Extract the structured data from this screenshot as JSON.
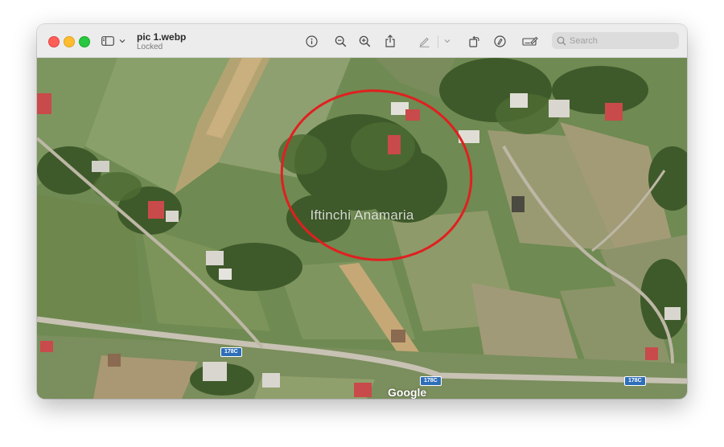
{
  "window": {
    "title": "pic 1.webp",
    "subtitle": "Locked"
  },
  "toolbar": {
    "sidebar_toggle_icon": "sidebar-icon",
    "info_icon": "info-icon",
    "zoom_out_icon": "zoom-out-icon",
    "zoom_in_icon": "zoom-in-icon",
    "share_icon": "share-icon",
    "markup_icon": "pen-icon",
    "rotate_icon": "rotate-icon",
    "annotate_icon": "markup-circle-icon",
    "form_icon": "signature-icon"
  },
  "search": {
    "placeholder": "Search"
  },
  "image": {
    "watermark": "Iftinchi Anamaria",
    "attribution": "Google",
    "road_labels": [
      "178C",
      "178C",
      "178C"
    ],
    "highlight_color": "#e02020"
  }
}
